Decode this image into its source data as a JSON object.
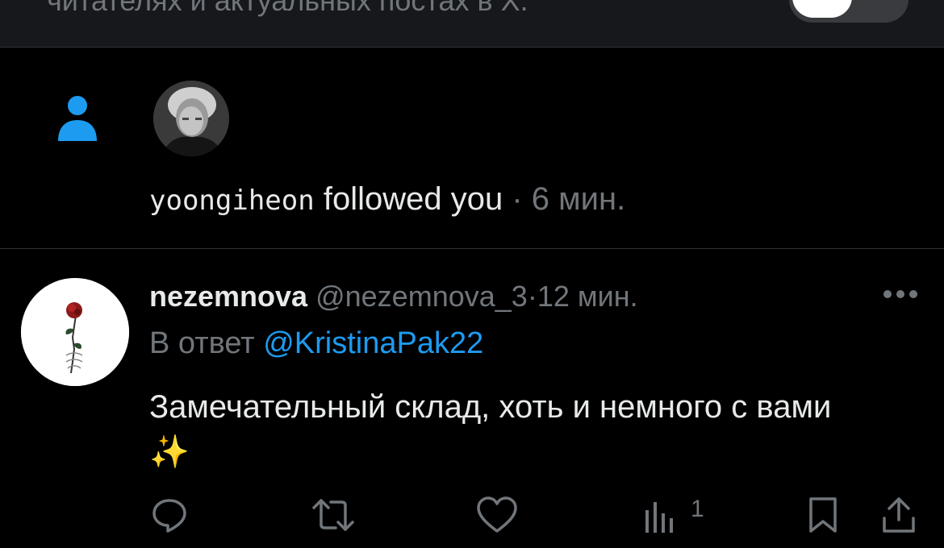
{
  "banner": {
    "text": "читателях и актуальных постах в X."
  },
  "follow": {
    "username": "yoongiheon",
    "action": "followed you",
    "separator": "·",
    "time": "6 мин."
  },
  "tweet": {
    "display_name": "nezemnova",
    "handle": "@nezemnova_3",
    "separator": "·",
    "time": "12 мин.",
    "reply_prefix": "В ответ",
    "reply_mention": "@KristinaPak22",
    "text": "Замечательный склад, хоть и немного с вами ✨",
    "views": "1"
  },
  "colors": {
    "background": "#000000",
    "accent": "#1d9bf0",
    "muted": "#71767b",
    "text": "#e7e9ea"
  },
  "icons": [
    "person-icon",
    "more-icon",
    "reply-icon",
    "retweet-icon",
    "like-icon",
    "views-icon",
    "bookmark-icon",
    "share-icon"
  ]
}
